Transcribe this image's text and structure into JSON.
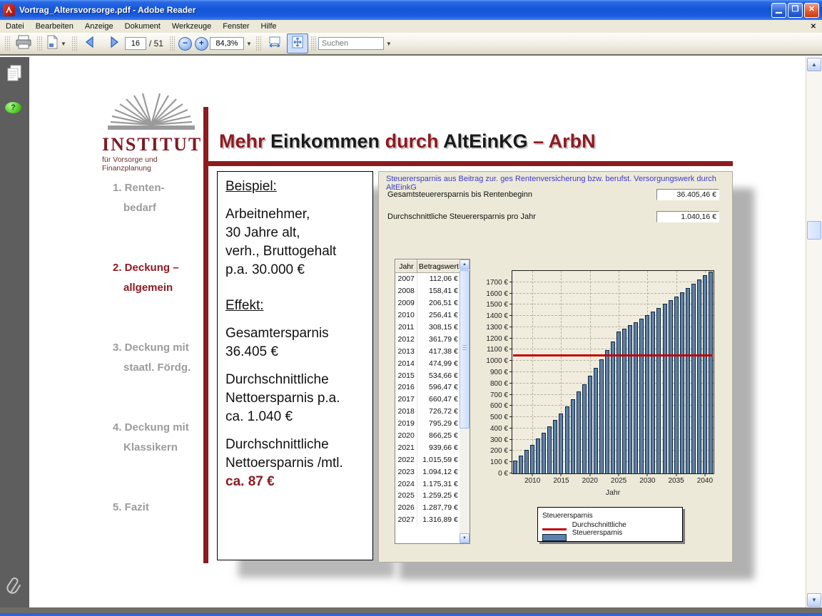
{
  "window": {
    "title": "Vortrag_Altersvorsorge.pdf - Adobe Reader"
  },
  "menu": {
    "items": [
      "Datei",
      "Bearbeiten",
      "Anzeige",
      "Dokument",
      "Werkzeuge",
      "Fenster",
      "Hilfe"
    ],
    "close": "✕"
  },
  "toolbar": {
    "page_current": "16",
    "page_total": "/ 51",
    "zoom_value": "84,3%",
    "search_placeholder": "Suchen"
  },
  "slide": {
    "logo_title": "INSTITUT",
    "logo_subtitle": "für Vorsorge und Finanzplanung",
    "title_parts": [
      {
        "text": "Mehr ",
        "red": true
      },
      {
        "text": "Einkommen ",
        "red": false
      },
      {
        "text": "durch ",
        "red": true
      },
      {
        "text": "AltEinKG ",
        "red": false
      },
      {
        "text": "– ArbN",
        "red": true
      }
    ],
    "nav": [
      {
        "lines": [
          "1. Renten-",
          "bedarf"
        ],
        "active": false
      },
      {
        "lines": [
          "2. Deckung –",
          "allgemein"
        ],
        "active": true
      },
      {
        "lines": [
          "3. Deckung mit",
          "staatl. Fördg."
        ],
        "active": false
      },
      {
        "lines": [
          "4. Deckung mit",
          "Klassikern"
        ],
        "active": false
      },
      {
        "lines": [
          "5. Fazit"
        ],
        "active": false
      }
    ],
    "example": {
      "paragraphs": [
        {
          "text": "Beispiel:",
          "underline": true
        },
        {
          "text": "Arbeitnehmer,\n30 Jahre alt,\nverh., Bruttogehalt\np.a. 30.000 €"
        },
        {
          "text": "Effekt:",
          "underline": true,
          "gap": true
        },
        {
          "text": "Gesamtersparnis\n36.405 €"
        },
        {
          "text": "Durchschnittliche\nNettoersparnis p.a.\nca. 1.040 €"
        },
        {
          "text": "Durchschnittliche\nNettoersparnis /mtl."
        },
        {
          "text": "ca. 87 €",
          "highlight": true,
          "tight": true
        }
      ]
    }
  },
  "panel": {
    "header": "Steuerersparnis aus Beitrag zur. ges Rentenversicherung bzw. berufst. Versorgungswerk durch AltEinkG",
    "fields": [
      {
        "label": "Gesamtsteuerersparnis bis Rentenbeginn",
        "value": "36.405,46 €"
      },
      {
        "label": "Durchschnittliche Steuerersparnis pro Jahr",
        "value": "1.040,16 €"
      }
    ],
    "table": {
      "headers": [
        "Jahr",
        "Betragswert"
      ],
      "rows": [
        [
          "2007",
          "112,06 €"
        ],
        [
          "2008",
          "158,41 €"
        ],
        [
          "2009",
          "206,51 €"
        ],
        [
          "2010",
          "256,41 €"
        ],
        [
          "2011",
          "308,15 €"
        ],
        [
          "2012",
          "361,79 €"
        ],
        [
          "2013",
          "417,38 €"
        ],
        [
          "2014",
          "474,99 €"
        ],
        [
          "2015",
          "534,66 €"
        ],
        [
          "2016",
          "596,47 €"
        ],
        [
          "2017",
          "660,47 €"
        ],
        [
          "2018",
          "726,72 €"
        ],
        [
          "2019",
          "795,29 €"
        ],
        [
          "2020",
          "866,25 €"
        ],
        [
          "2021",
          "939,66 €"
        ],
        [
          "2022",
          "1.015,59 €"
        ],
        [
          "2023",
          "1.094,12 €"
        ],
        [
          "2024",
          "1.175,31 €"
        ],
        [
          "2025",
          "1.259,25 €"
        ],
        [
          "2026",
          "1.287,79 €"
        ],
        [
          "2027",
          "1.316,89 €"
        ]
      ]
    }
  },
  "chart_data": {
    "type": "bar",
    "xlabel": "Jahr",
    "ylabel": "",
    "x": [
      2007,
      2008,
      2009,
      2010,
      2011,
      2012,
      2013,
      2014,
      2015,
      2016,
      2017,
      2018,
      2019,
      2020,
      2021,
      2022,
      2023,
      2024,
      2025,
      2026,
      2027,
      2028,
      2029,
      2030,
      2031,
      2032,
      2033,
      2034,
      2035,
      2036,
      2037,
      2038,
      2039,
      2040,
      2041
    ],
    "series": [
      {
        "name": "Steuerersparnis",
        "type": "bar",
        "color": "#5d81a9",
        "values": [
          112.06,
          158.41,
          206.51,
          256.41,
          308.15,
          361.79,
          417.38,
          474.99,
          534.66,
          596.47,
          660.47,
          726.72,
          795.29,
          866.25,
          939.66,
          1015.59,
          1094.12,
          1175.31,
          1259.25,
          1287.79,
          1316.89,
          1346.5,
          1377.0,
          1408.0,
          1439.9,
          1472.3,
          1505.6,
          1539.7,
          1574.5,
          1610.1,
          1646.4,
          1683.5,
          1721.6,
          1760.5,
          1795.0
        ]
      },
      {
        "name": "Durchschnittliche Steuerersparnis",
        "type": "line",
        "color": "#c00404",
        "value": 1040.16
      }
    ],
    "ylim": [
      0,
      1800
    ],
    "ytick_step": 100,
    "ytick_max": 1700,
    "ytick_suffix": " €",
    "xticks": [
      2010,
      2015,
      2020,
      2025,
      2030,
      2035,
      2040
    ],
    "grid": true,
    "legend_position": "bottom"
  }
}
